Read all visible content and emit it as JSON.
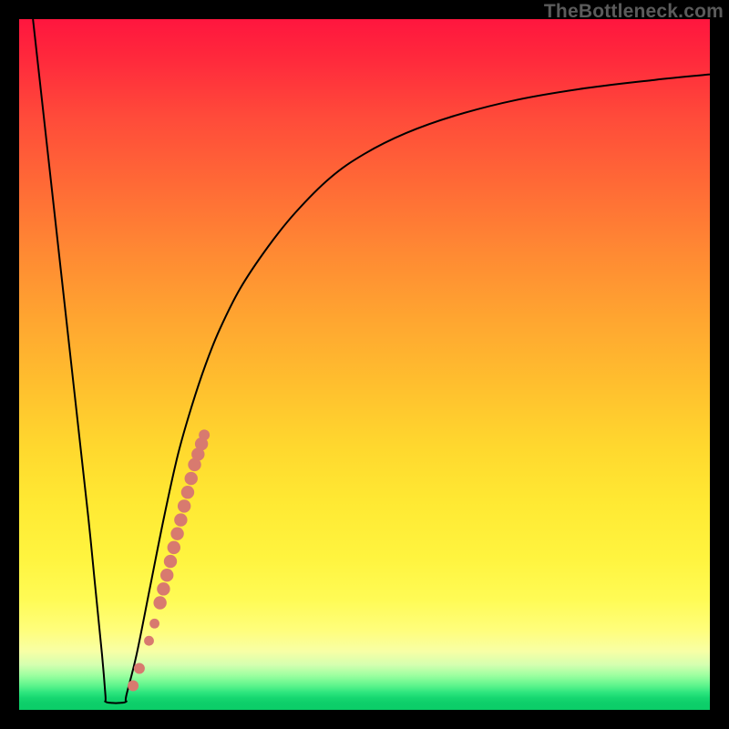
{
  "watermark": {
    "text": "TheBottleneck.com"
  },
  "colors": {
    "frame": "#000000",
    "curve": "#000000",
    "marker": "#d87a6f",
    "gradient_top": "#ff163e",
    "gradient_bottom": "#0bcd68"
  },
  "chart_data": {
    "type": "line",
    "title": "",
    "xlabel": "",
    "ylabel": "",
    "xlim": [
      0,
      100
    ],
    "ylim": [
      0,
      100
    ],
    "grid": false,
    "legend": false,
    "series": [
      {
        "name": "left-branch",
        "x": [
          2,
          4,
          6,
          8,
          10,
          11,
          12,
          12.5
        ],
        "y": [
          100,
          82,
          64,
          46,
          28,
          18,
          8,
          2
        ]
      },
      {
        "name": "valley-floor",
        "x": [
          12.5,
          13.5,
          14.5,
          15.5
        ],
        "y": [
          1.2,
          1.0,
          1.0,
          1.2
        ]
      },
      {
        "name": "right-branch",
        "x": [
          15.5,
          17,
          19,
          21,
          23,
          25,
          27,
          29,
          32,
          36,
          40,
          45,
          50,
          56,
          63,
          72,
          82,
          92,
          100
        ],
        "y": [
          2,
          8,
          18,
          28,
          37,
          44,
          50,
          55,
          61,
          67,
          72,
          77,
          80.5,
          83.5,
          86,
          88.3,
          90,
          91.2,
          92
        ]
      }
    ],
    "markers": {
      "name": "highlighted-points",
      "color": "#d87a6f",
      "points": [
        {
          "x": 16.5,
          "y": 3.5,
          "r": 1.0
        },
        {
          "x": 17.4,
          "y": 6.0,
          "r": 1.0
        },
        {
          "x": 18.8,
          "y": 10.0,
          "r": 0.9
        },
        {
          "x": 19.6,
          "y": 12.5,
          "r": 0.9
        },
        {
          "x": 20.4,
          "y": 15.5,
          "r": 1.2
        },
        {
          "x": 20.9,
          "y": 17.5,
          "r": 1.2
        },
        {
          "x": 21.4,
          "y": 19.5,
          "r": 1.2
        },
        {
          "x": 21.9,
          "y": 21.5,
          "r": 1.2
        },
        {
          "x": 22.4,
          "y": 23.5,
          "r": 1.2
        },
        {
          "x": 22.9,
          "y": 25.5,
          "r": 1.2
        },
        {
          "x": 23.4,
          "y": 27.5,
          "r": 1.2
        },
        {
          "x": 23.9,
          "y": 29.5,
          "r": 1.2
        },
        {
          "x": 24.4,
          "y": 31.5,
          "r": 1.2
        },
        {
          "x": 24.9,
          "y": 33.5,
          "r": 1.2
        },
        {
          "x": 25.4,
          "y": 35.5,
          "r": 1.2
        },
        {
          "x": 25.9,
          "y": 37.0,
          "r": 1.2
        },
        {
          "x": 26.4,
          "y": 38.5,
          "r": 1.2
        },
        {
          "x": 26.8,
          "y": 39.8,
          "r": 1.0
        }
      ]
    }
  }
}
